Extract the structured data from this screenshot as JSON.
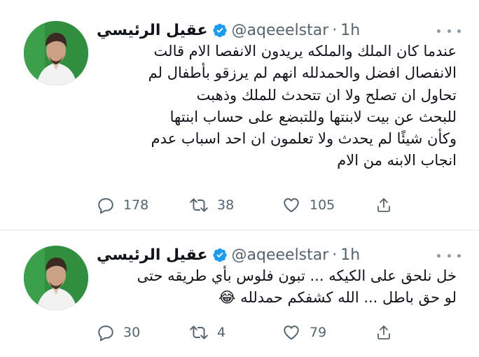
{
  "tweets": [
    {
      "author_name": "عقيل الرئيسي",
      "handle": "@aqeeelstar",
      "separator": "·",
      "time": "1h",
      "text": "عندما  كان الملك والملكه يريدون الانفصا الام قالت\nالانفصال افضل والحمدلله انهم لم يرزقو بأطفال لم\nتحاول ان تصلح ولا ان تتحدث للملك وذهبت\nللبحث عن بيت لابنتها وللتبضع على حساب ابنتها\nوكأن شيئًا لم يحدث ولا تعلمون ان احد اسباب عدم\nانجاب الابنه من الام",
      "replies": "178",
      "retweets": "38",
      "likes": "105"
    },
    {
      "author_name": "عقيل الرئيسي",
      "handle": "@aqeeelstar",
      "separator": "·",
      "time": "1h",
      "text": "خل نلحق على الكيكه ... تبون فلوس بأي طريقه حتى\nلو حق باطل ... الله كشفكم حمدلله 😂",
      "replies": "30",
      "retweets": "4",
      "likes": "79"
    }
  ],
  "icons": {
    "verified": "verified-badge-icon",
    "more": "more-options-icon",
    "reply": "reply-icon",
    "retweet": "retweet-icon",
    "like": "like-icon",
    "share": "share-icon"
  },
  "colors": {
    "accent": "#1d9bf0",
    "text": "#0f1419",
    "secondary": "#536471",
    "avatar_bg": "#2e8b3c"
  }
}
